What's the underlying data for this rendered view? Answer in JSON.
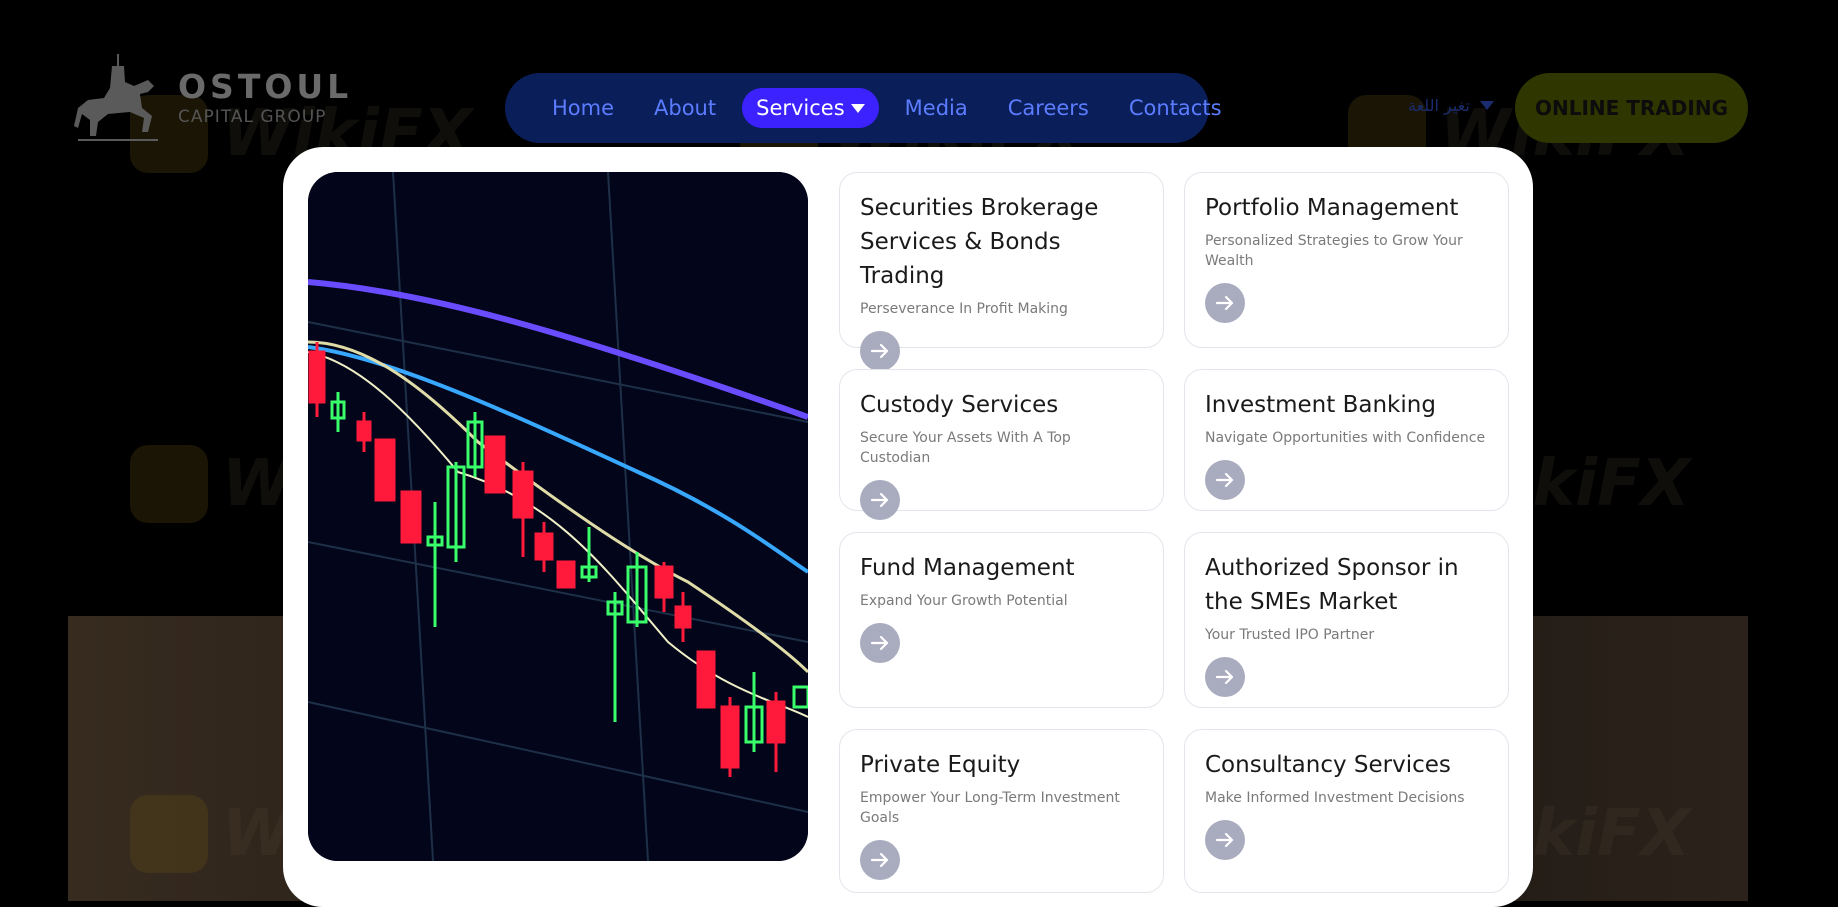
{
  "header": {
    "logo_name": "OSTOUL",
    "logo_sub": "CAPITAL GROUP",
    "nav": [
      {
        "label": "Home"
      },
      {
        "label": "About"
      },
      {
        "label": "Services"
      },
      {
        "label": "Media"
      },
      {
        "label": "Careers"
      },
      {
        "label": "Contacts"
      }
    ],
    "language_label": "تغير اللغة",
    "cta_label": "ONLINE TRADING"
  },
  "watermark": {
    "text": "WikiFX"
  },
  "services_menu": {
    "cards": [
      {
        "title": "Securities Brokerage Services & Bonds Trading",
        "subtitle": "Perseverance In Profit Making"
      },
      {
        "title": "Portfolio Management",
        "subtitle": "Personalized Strategies to Grow Your Wealth"
      },
      {
        "title": "Custody Services",
        "subtitle": "Secure Your Assets With A Top Custodian"
      },
      {
        "title": "Investment Banking",
        "subtitle": "Navigate Opportunities with Confidence"
      },
      {
        "title": "Fund Management",
        "subtitle": "Expand Your Growth Potential"
      },
      {
        "title": "Authorized Sponsor in the SMEs Market",
        "subtitle": "Your Trusted IPO Partner"
      },
      {
        "title": "Private Equity",
        "subtitle": "Empower Your Long-Term Investment Goals"
      },
      {
        "title": "Consultancy Services",
        "subtitle": "Make Informed Investment Decisions"
      }
    ]
  },
  "colors": {
    "nav_bg": "#0a1f5a",
    "nav_text": "#5c7cff",
    "nav_active": "#3b22ff",
    "cta_bg": "#2f3600",
    "arrow_bg": "#a9abbf"
  }
}
